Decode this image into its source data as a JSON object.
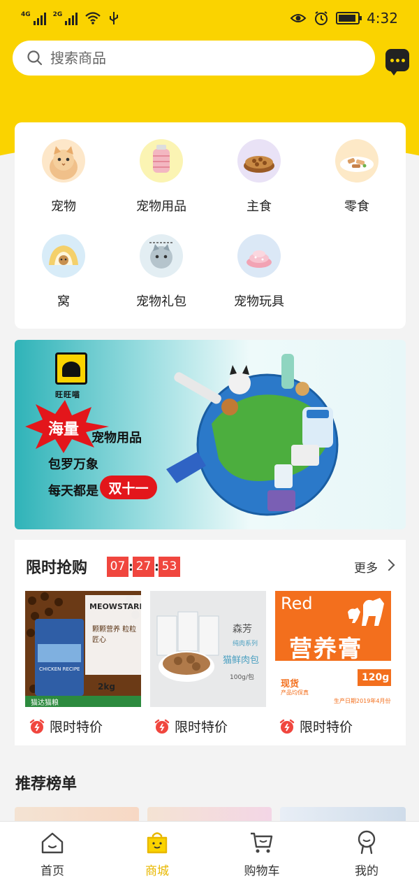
{
  "status_bar": {
    "net1": "4G",
    "net2": "2G",
    "time": "4:32"
  },
  "search": {
    "placeholder": "搜索商品",
    "icon": "search-icon"
  },
  "header": {
    "message_icon": "chat-bubble-icon"
  },
  "categories": [
    {
      "label": "宠物",
      "icon": "cat-icon"
    },
    {
      "label": "宠物用品",
      "icon": "pet-supplies-icon"
    },
    {
      "label": "主食",
      "icon": "pet-food-icon"
    },
    {
      "label": "零食",
      "icon": "snack-icon"
    },
    {
      "label": "窝",
      "icon": "pet-bed-icon"
    },
    {
      "label": "宠物礼包",
      "icon": "gift-pack-icon"
    },
    {
      "label": "宠物玩具",
      "icon": "pet-toy-icon"
    }
  ],
  "banner": {
    "brand": "旺旺喵",
    "burst_text": "海量",
    "line1": "宠物用品",
    "line2": "包罗万象",
    "line3": "每天都是",
    "line3_badge": "双十一"
  },
  "flash_sale": {
    "title": "限时抢购",
    "countdown": {
      "h": "07",
      "m": "27",
      "s": "53"
    },
    "more_label": "更多",
    "products": [
      {
        "tag": "限时特价",
        "brand_text": "MEOWSTARD",
        "sub_text": "颗颗营养 粒粒匠心",
        "bag_text": "CHICKEN RECIPE",
        "footer_text": "猫达猫粮",
        "weight": "2kg"
      },
      {
        "tag": "限时特价",
        "brand_text": "森芳",
        "series": "纯肉系列",
        "name": "猫鲜肉包",
        "weight": "100g/包"
      },
      {
        "tag": "限时特价",
        "brand_text": "Red",
        "name": "营养膏",
        "weight": "120g",
        "note": "现货",
        "note2": "产品均保真",
        "note3": "生产日期2019年4月份"
      }
    ]
  },
  "recommend": {
    "title": "推荐榜单"
  },
  "tabbar": {
    "items": [
      {
        "label": "首页",
        "icon": "home-icon"
      },
      {
        "label": "商城",
        "icon": "shop-bag-icon",
        "active": true
      },
      {
        "label": "购物车",
        "icon": "cart-icon"
      },
      {
        "label": "我的",
        "icon": "profile-icon"
      }
    ]
  },
  "colors": {
    "brand_yellow": "#fad300",
    "countdown_red": "#f0463e",
    "active_tab": "#e8b800"
  }
}
